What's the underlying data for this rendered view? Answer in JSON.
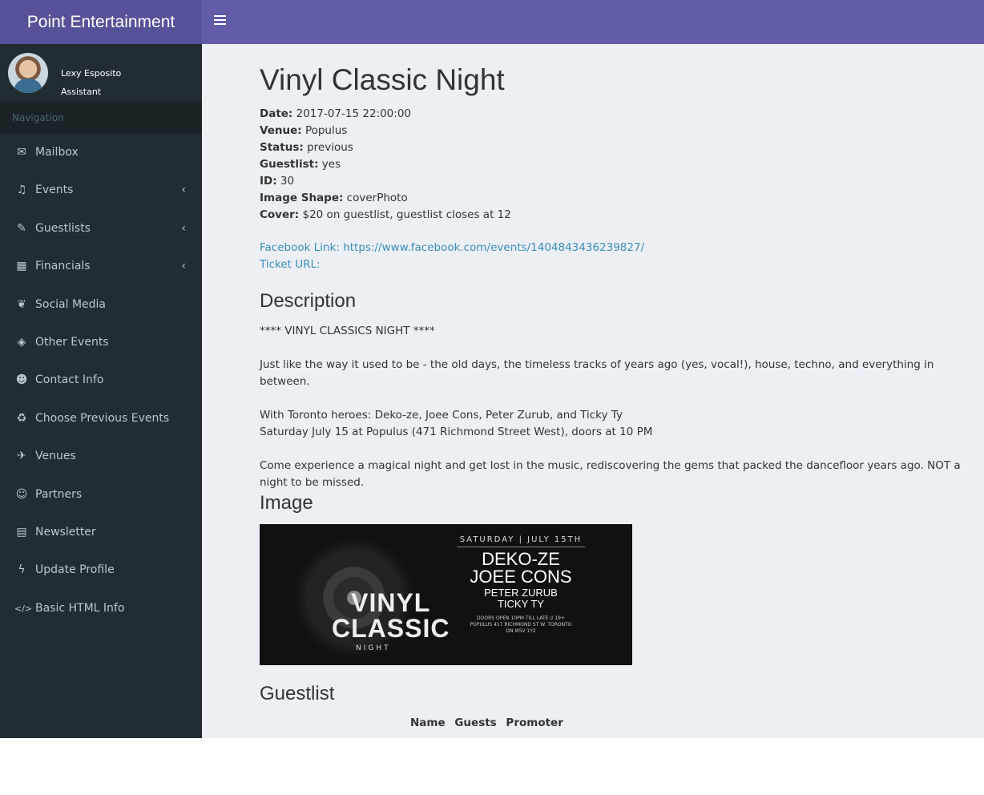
{
  "header": {
    "brand": "Point Entertainment"
  },
  "user": {
    "name": "Lexy Esposito",
    "role": "Assistant"
  },
  "sidebar": {
    "section_label": "Navigation",
    "items": [
      {
        "label": "Mailbox",
        "icon": "envelope-icon",
        "glyph": "✉",
        "chevron": false
      },
      {
        "label": "Events",
        "icon": "music-icon",
        "glyph": "♫",
        "chevron": true
      },
      {
        "label": "Guestlists",
        "icon": "pencil-icon",
        "glyph": "✎",
        "chevron": true
      },
      {
        "label": "Financials",
        "icon": "calculator-icon",
        "glyph": "▦",
        "chevron": true
      },
      {
        "label": "Social Media",
        "icon": "paw-icon",
        "glyph": "❦",
        "chevron": false
      },
      {
        "label": "Other Events",
        "icon": "ticket-icon",
        "glyph": "◈",
        "chevron": false
      },
      {
        "label": "Contact Info",
        "icon": "user-icon",
        "glyph": "☻",
        "chevron": false
      },
      {
        "label": "Choose Previous Events",
        "icon": "recycle-icon",
        "glyph": "♻",
        "chevron": false
      },
      {
        "label": "Venues",
        "icon": "plane-icon",
        "glyph": "✈",
        "chevron": false
      },
      {
        "label": "Partners",
        "icon": "users-icon",
        "glyph": "☺",
        "chevron": false
      },
      {
        "label": "Newsletter",
        "icon": "newspaper-icon",
        "glyph": "▤",
        "chevron": false
      },
      {
        "label": "Update Profile",
        "icon": "bolt-icon",
        "glyph": "ϟ",
        "chevron": false
      },
      {
        "label": "Basic HTML Info",
        "icon": "code-icon",
        "glyph": "</>",
        "chevron": false
      }
    ]
  },
  "event": {
    "title": "Vinyl Classic Night",
    "fields": [
      {
        "key": "Date:",
        "value": " 2017-07-15 22:00:00"
      },
      {
        "key": "Venue:",
        "value": " Populus"
      },
      {
        "key": "Status:",
        "value": " previous"
      },
      {
        "key": "Guestlist:",
        "value": " yes"
      },
      {
        "key": "ID:",
        "value": " 30"
      },
      {
        "key": "Image Shape:",
        "value": " coverPhoto"
      },
      {
        "key": "Cover:",
        "value": " $20 on guestlist, guestlist closes at 12"
      }
    ],
    "facebook_link": "Facebook Link: https://www.facebook.com/events/1404843436239827/",
    "ticket_url": "Ticket URL:",
    "description_heading": "Description",
    "description": [
      "**** VINYL CLASSICS NIGHT ****",
      "Just like the way it used to be - the old days, the timeless tracks of years ago (yes, vocal!), house, techno, and everything in between.",
      "With Toronto heroes: Deko-ze, Joee Cons, Peter Zurub, and Ticky Ty",
      "Saturday July 15 at Populus (471 Richmond Street West), doors at 10 PM",
      "Come experience a magical night and get lost in the music, rediscovering the gems that packed the dancefloor years ago. NOT a night to be missed."
    ],
    "image_heading": "Image",
    "flyer": {
      "date": "SATURDAY | JULY 15TH",
      "artist1": "DEKO-ZE",
      "artist2": "JOEE CONS",
      "artist3": "PETER ZURUB",
      "artist4": "TICKY TY",
      "small1": "DOORS OPEN 10PM TILL LATE // 19+",
      "small2": "POPULUS 417 RICHMOND ST W. TORONTO",
      "small3": "ON M5V 1Y2",
      "title1": "VINYL",
      "title2": "CLASSIC",
      "title3": "NIGHT"
    },
    "guestlist_heading": "Guestlist",
    "guestlist_columns": [
      "Name",
      "Guests",
      "Promoter"
    ]
  }
}
